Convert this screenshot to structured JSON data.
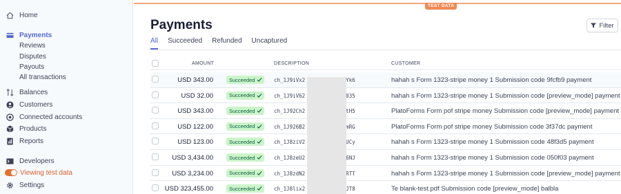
{
  "sidebar": {
    "home": "Home",
    "payments": "Payments",
    "payments_sub": [
      "Reviews",
      "Disputes",
      "Payouts",
      "All transactions"
    ],
    "items": [
      {
        "label": "Balances",
        "icon": "balance-icon"
      },
      {
        "label": "Customers",
        "icon": "customer-icon"
      },
      {
        "label": "Connected accounts",
        "icon": "connect-icon"
      },
      {
        "label": "Products",
        "icon": "box-icon"
      },
      {
        "label": "Reports",
        "icon": "report-icon"
      }
    ],
    "developers": "Developers",
    "test_toggle": "Viewing test data",
    "settings": "Settings"
  },
  "header": {
    "test_badge": "TEST DATA",
    "title": "Payments",
    "filter": "Filter"
  },
  "tabs": [
    "All",
    "Succeeded",
    "Refunded",
    "Uncaptured"
  ],
  "columns": {
    "amount": "AMOUNT",
    "description": "DESCRIPTION",
    "customer": "CUSTOMER"
  },
  "rows": [
    {
      "amount": "USD 343.00",
      "status": "Succeeded",
      "desc": "ch_1J9iVx2",
      "desc_end": "AVYk6",
      "customer": "hahah s Form 1323-stripe money 1 Submission code 9fcfb9 payment"
    },
    {
      "amount": "USD 32.00",
      "status": "Succeeded",
      "desc": "ch_1J9iV62",
      "desc_end": "FJ035",
      "customer": "hahah s Form 1323-stripe money 1 Submission code [preview_mode] payment"
    },
    {
      "amount": "USD 343.00",
      "status": "Succeeded",
      "desc": "ch_1J92Ch2",
      "desc_end": "LItH5",
      "customer": "PlatoForms Form pof stripe money Submission code [preview_mode] payment"
    },
    {
      "amount": "USD 122.00",
      "status": "Succeeded",
      "desc": "ch_1J926B2",
      "desc_end": "5umRG",
      "customer": "PlatoForms Form pof stripe money Submission code 3f37dc payment"
    },
    {
      "amount": "USD 123.00",
      "status": "Succeeded",
      "desc": "ch_1J8ziV2",
      "desc_end": "gwUCy",
      "customer": "hahah s Form 1323-stripe money 1 Submission code 48f3d5 payment"
    },
    {
      "amount": "USD 3,434.00",
      "status": "Succeeded",
      "desc": "ch_1J8zeU2",
      "desc_end": "tU6NJ",
      "customer": "hahah s Form 1323-stripe money 1 Submission code 050f03 payment"
    },
    {
      "amount": "USD 3,234.00",
      "status": "Succeeded",
      "desc": "ch_1J8zdN2",
      "desc_end": "6fRTT",
      "customer": "hahah s Form 1323-stripe money 1 Submission code [preview_mode] payment"
    },
    {
      "amount": "USD 323,455.00",
      "status": "Succeeded",
      "desc": "ch_1J8lix2",
      "desc_end": "QrJT8",
      "customer": "Te blank-test.pdf Submission code [preview_mode] balbla"
    }
  ],
  "colors": {
    "accent": "#5469d4",
    "success_bg": "#cbf4c9",
    "success_fg": "#0e6245",
    "test": "#e56f2e"
  }
}
